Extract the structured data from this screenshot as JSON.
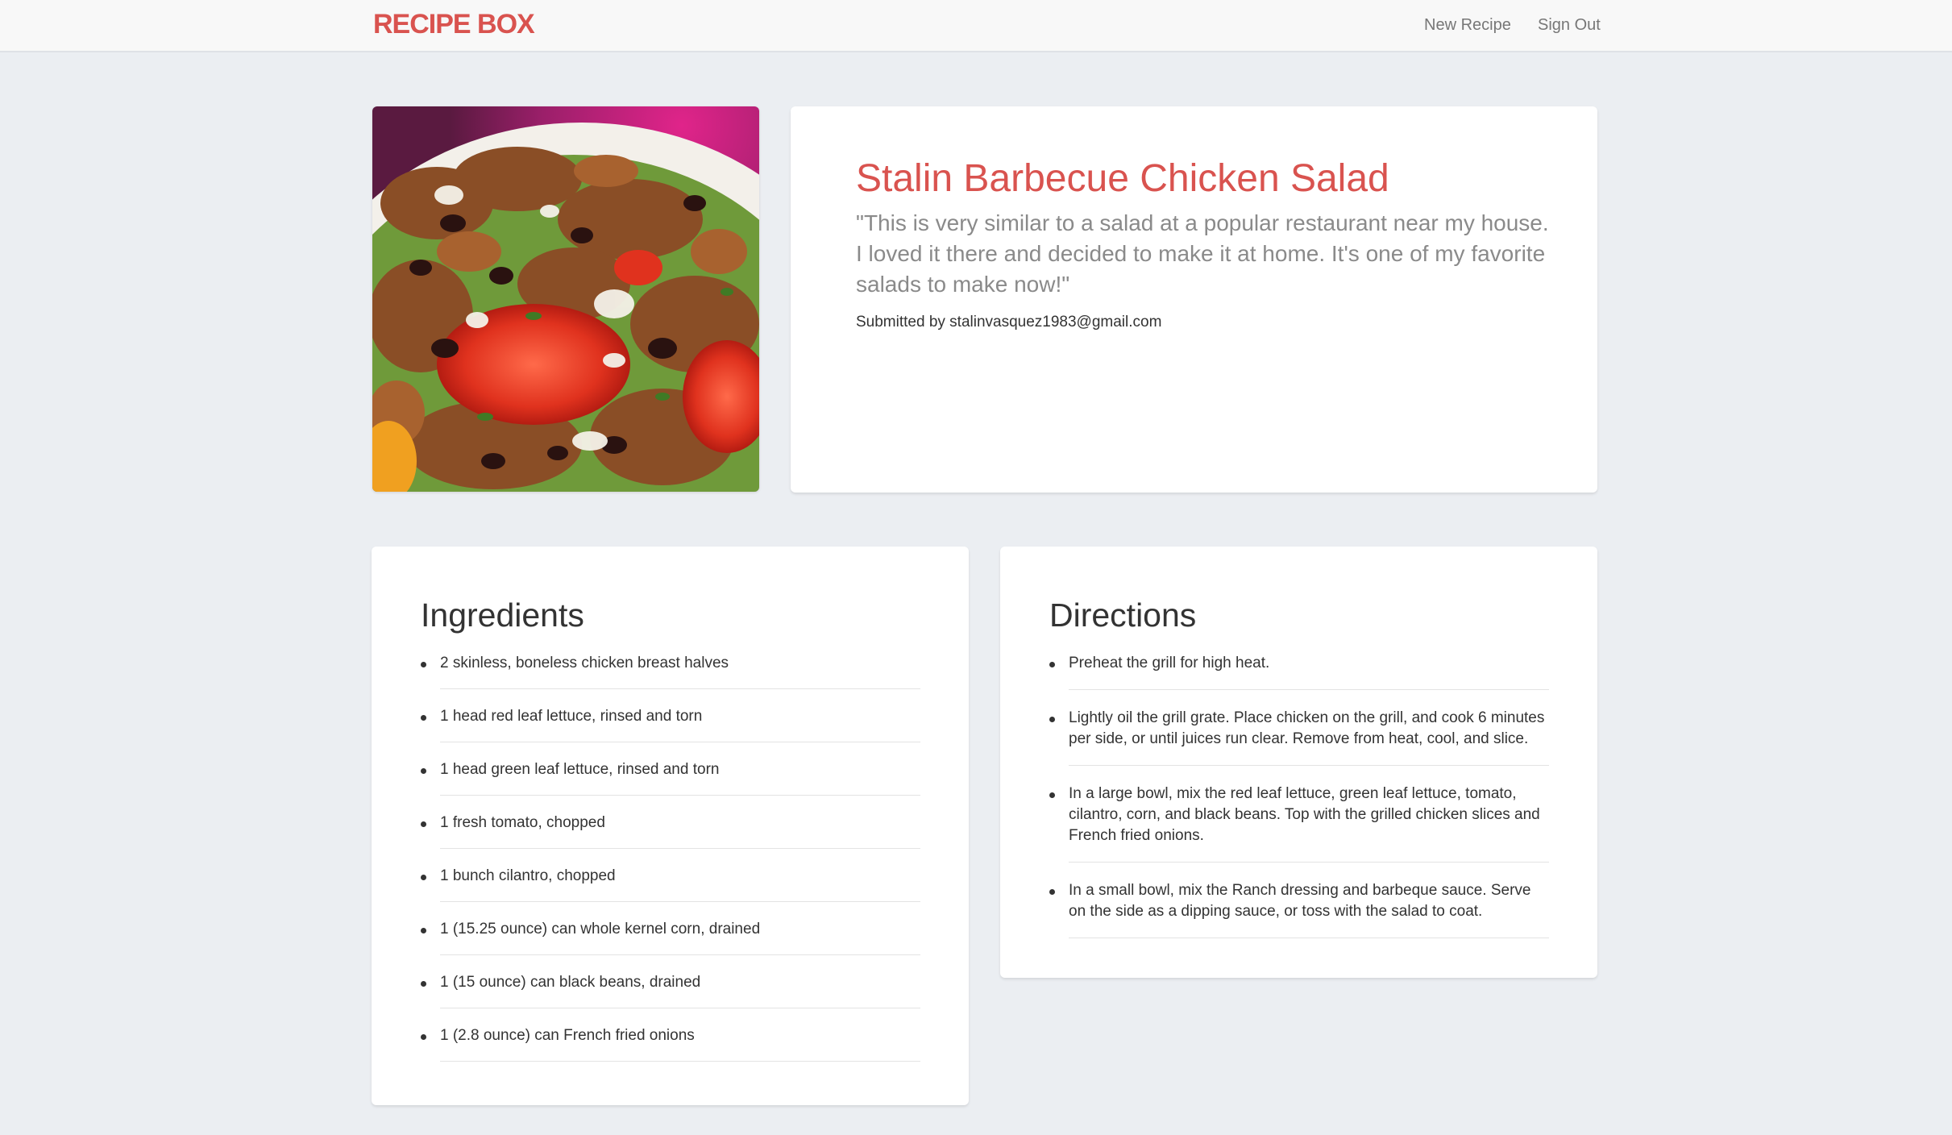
{
  "nav": {
    "brand": "RECIPE BOX",
    "new_recipe": "New Recipe",
    "sign_out": "Sign Out"
  },
  "recipe": {
    "title": "Stalin Barbecue Chicken Salad",
    "description": "\"This is very similar to a salad at a popular restaurant near my house. I loved it there and decided to make it at home. It's one of my favorite salads to make now!\"",
    "submitted_by": "Submitted by stalinvasquez1983@gmail.com",
    "photo_icon": "salad-photo"
  },
  "ingredients": {
    "heading": "Ingredients",
    "items": [
      "2 skinless, boneless chicken breast halves",
      "1 head red leaf lettuce, rinsed and torn",
      "1 head green leaf lettuce, rinsed and torn",
      "1 fresh tomato, chopped",
      "1 bunch cilantro, chopped",
      "1 (15.25 ounce) can whole kernel corn, drained",
      "1 (15 ounce) can black beans, drained",
      "1 (2.8 ounce) can French fried onions"
    ]
  },
  "directions": {
    "heading": "Directions",
    "items": [
      "Preheat the grill for high heat.",
      "Lightly oil the grill grate. Place chicken on the grill, and cook 6 minutes per side, or until juices run clear. Remove from heat, cool, and slice.",
      "In a large bowl, mix the red leaf lettuce, green leaf lettuce, tomato, cilantro, corn, and black beans. Top with the grilled chicken slices and French fried onions.",
      "In a small bowl, mix the Ranch dressing and barbeque sauce. Serve on the side as a dipping sauce, or toss with the salad to coat."
    ]
  },
  "colors": {
    "accent": "#d9534f",
    "background": "#ebeef2"
  }
}
